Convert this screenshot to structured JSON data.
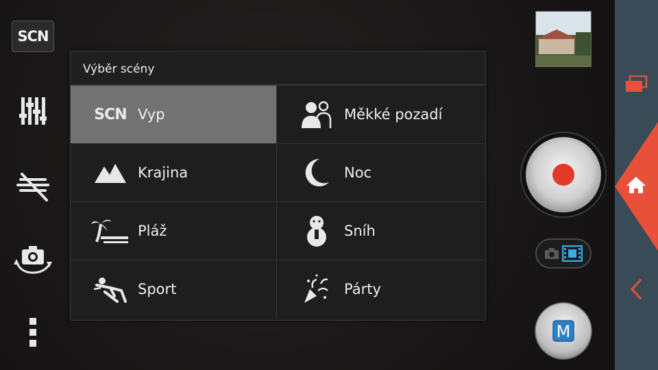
{
  "left_toolbar": {
    "scene_badge": "SCN"
  },
  "scene_menu": {
    "title": "Výběr scény",
    "items": [
      {
        "icon": "scn-icon",
        "icon_text": "SCN",
        "label": "Vyp",
        "selected": true
      },
      {
        "icon": "soft-background-icon",
        "label": "Měkké pozadí",
        "selected": false
      },
      {
        "icon": "mountains-icon",
        "label": "Krajina",
        "selected": false
      },
      {
        "icon": "moon-icon",
        "label": "Noc",
        "selected": false
      },
      {
        "icon": "beach-icon",
        "label": "Pláž",
        "selected": false
      },
      {
        "icon": "snowman-icon",
        "label": "Sníh",
        "selected": false
      },
      {
        "icon": "sport-icon",
        "label": "Sport",
        "selected": false
      },
      {
        "icon": "party-icon",
        "label": "Párty",
        "selected": false
      }
    ]
  },
  "mode_button": {
    "label": "M"
  },
  "colors": {
    "accent_red": "#e8503a",
    "nav_bar": "#3a4b58",
    "selected_cell": "#727272",
    "video_icon_blue": "#39a9e8"
  }
}
